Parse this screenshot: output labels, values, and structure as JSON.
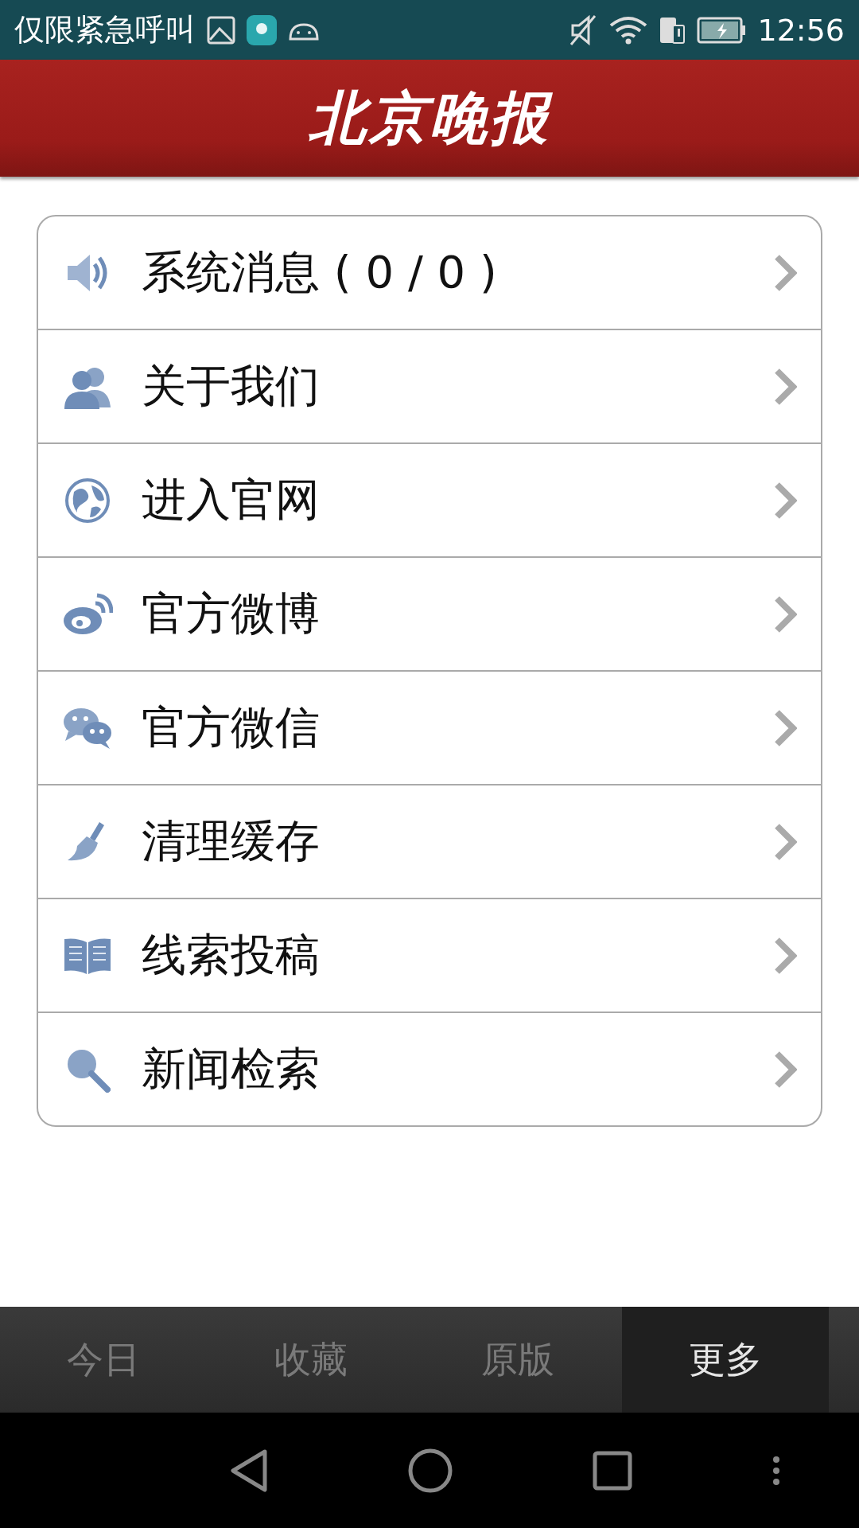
{
  "status_bar": {
    "carrier": "仅限紧急呼叫",
    "time": "12:56"
  },
  "header": {
    "title": "北京晚报"
  },
  "menu": [
    {
      "label": "系统消息 ( 0 / 0 )"
    },
    {
      "label": "关于我们"
    },
    {
      "label": "进入官网"
    },
    {
      "label": "官方微博"
    },
    {
      "label": "官方微信"
    },
    {
      "label": "清理缓存"
    },
    {
      "label": "线索投稿"
    },
    {
      "label": "新闻检索"
    }
  ],
  "tabs": [
    {
      "label": "今日",
      "selected": false
    },
    {
      "label": "收藏",
      "selected": false
    },
    {
      "label": "原版",
      "selected": false
    },
    {
      "label": "更多",
      "selected": true
    }
  ]
}
